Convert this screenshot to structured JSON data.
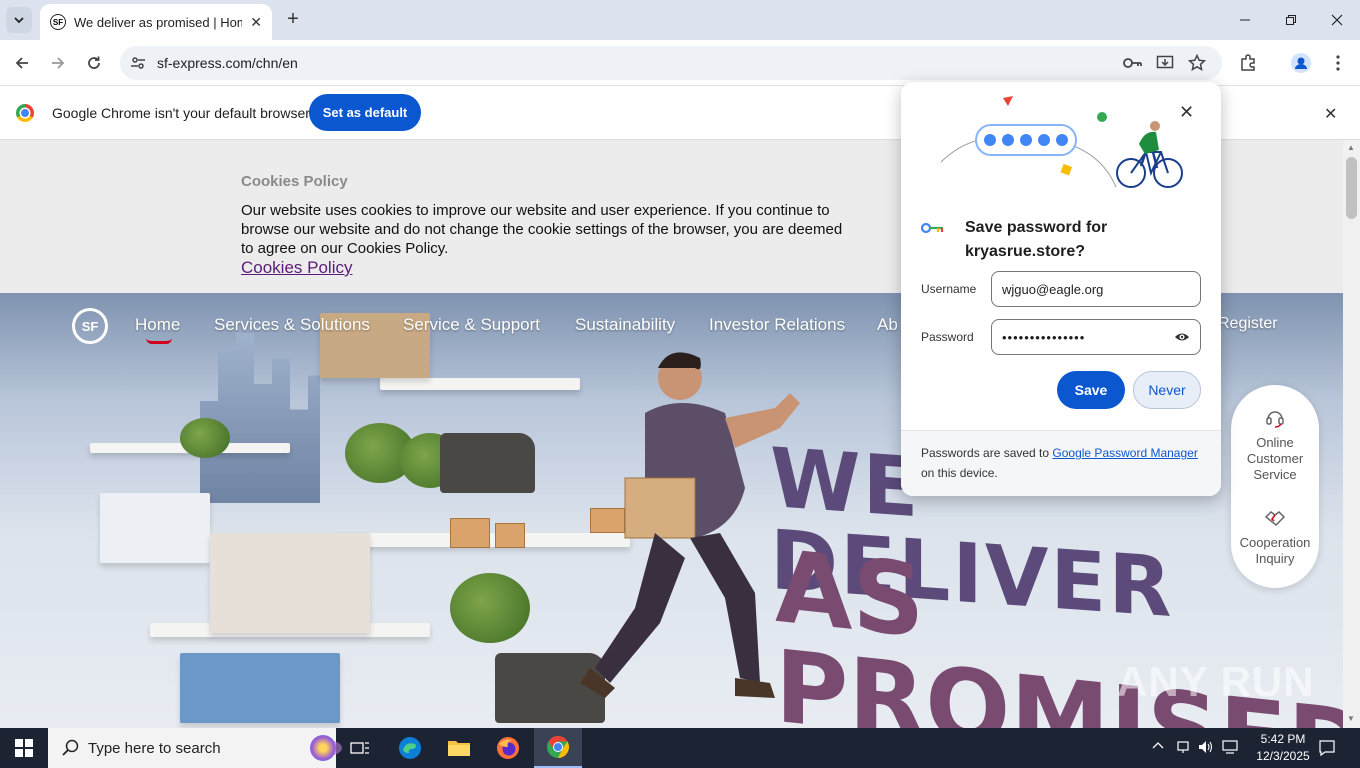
{
  "browser": {
    "tab_title": "We deliver as promised | Home",
    "tab_favicon": "SF",
    "url": "sf-express.com/chn/en"
  },
  "infobar": {
    "message": "Google Chrome isn't your default browser",
    "button": "Set as default"
  },
  "cookie_banner": {
    "title": "Cookies Policy",
    "text": "Our website uses cookies to improve our website and user experience. If you continue to browse our website and do not change the cookie settings of the browser, you are deemed to agree on our Cookies Policy.",
    "link": "Cookies Policy"
  },
  "site_nav": {
    "logo": "SF",
    "items": [
      "Home",
      "Services & Solutions",
      "Service & Support",
      "Sustainability",
      "Investor Relations",
      "Ab",
      "Register"
    ]
  },
  "hero": {
    "headline_line1": "WE DELIVER",
    "headline_line2": "AS PROMISED"
  },
  "float_panel": {
    "item1": "Online Customer Service",
    "item2": "Cooperation Inquiry"
  },
  "password_bubble": {
    "title": "Save password for kryasrue.store?",
    "username_label": "Username",
    "username_value": "wjguo@eagle.org",
    "password_label": "Password",
    "password_value": "•••••••••••••••",
    "save": "Save",
    "never": "Never",
    "footer_pre": "Passwords are saved to ",
    "footer_link": "Google Password Manager",
    "footer_post": " on this device."
  },
  "watermark": "ANY RUN",
  "taskbar": {
    "search_placeholder": "Type here to search",
    "time": "5:42 PM",
    "date": "12/3/2025"
  },
  "colors": {
    "chrome_blue": "#0b57d0",
    "sf_red": "#d0021b",
    "taskbar": "#1c2333"
  }
}
